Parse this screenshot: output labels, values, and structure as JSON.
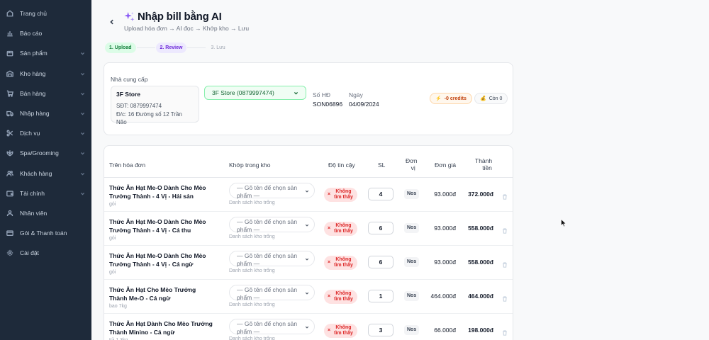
{
  "sidebar": {
    "items": [
      {
        "label": "Trang chủ",
        "icon": "home-icon",
        "chevron": false
      },
      {
        "label": "Báo cáo",
        "icon": "chart-icon",
        "chevron": false
      },
      {
        "label": "Sản phẩm",
        "icon": "box-icon",
        "chevron": true
      },
      {
        "label": "Kho hàng",
        "icon": "warehouse-icon",
        "chevron": true
      },
      {
        "label": "Bán hàng",
        "icon": "cart-icon",
        "chevron": true
      },
      {
        "label": "Nhập hàng",
        "icon": "truck-icon",
        "chevron": true
      },
      {
        "label": "Dịch vụ",
        "icon": "scissors-icon",
        "chevron": true
      },
      {
        "label": "Spa/Grooming",
        "icon": "spa-icon",
        "chevron": true
      },
      {
        "label": "Khách hàng",
        "icon": "users-icon",
        "chevron": true
      },
      {
        "label": "Tài chính",
        "icon": "wallet-icon",
        "chevron": true
      },
      {
        "label": "Nhân viên",
        "icon": "user-icon",
        "chevron": false
      },
      {
        "label": "Gói & Thanh toán",
        "icon": "card-icon",
        "chevron": false
      },
      {
        "label": "Cài đặt",
        "icon": "gear-icon",
        "chevron": false
      }
    ]
  },
  "header": {
    "title": "Nhập bill bằng AI",
    "subtitle": "Upload hóa đơn → AI đọc → Khớp kho → Lưu"
  },
  "steps": [
    "1. Upload",
    "2. Review",
    "3. Lưu"
  ],
  "supplier": {
    "label": "Nhà cung cấp",
    "name": "3F Store",
    "phone": "SĐT: 0879997474",
    "address": "Đ/c: 16 Đường số 12 Trần Não",
    "selected": "3F Store (0879997474)",
    "invoice_no_label": "Số HĐ",
    "invoice_no": "SON06896",
    "date_label": "Ngày",
    "date": "04/09/2024",
    "credits": "-0 credits",
    "remaining": "Còn 0"
  },
  "table": {
    "headers": {
      "name": "Trên hóa đơn",
      "match": "Khớp trong kho",
      "confidence": "Độ tin cậy",
      "qty": "SL",
      "unit_line1": "Đơn",
      "unit_line2": "vị",
      "price": "Đơn giá",
      "total_line1": "Thành",
      "total_line2": "tiền"
    },
    "match_placeholder_1": "— Gõ tên để chọn sản",
    "match_placeholder_2": "phẩm —",
    "empty_note": "Danh sách kho trống",
    "confidence_line1": "Không",
    "confidence_line2": "tìm thấy",
    "rows": [
      {
        "name": "Thức Ăn Hạt Me-O Dành Cho Mèo Trưởng Thành - 4 Vị - Hải sản",
        "unit_note": "gói",
        "qty": "4",
        "uom": "Nos",
        "price": "93.000đ",
        "total": "372.000đ"
      },
      {
        "name": "Thức Ăn Hạt Me-O Dành Cho Mèo Trưởng Thành - 4 Vị - Cá thu",
        "unit_note": "gói",
        "qty": "6",
        "uom": "Nos",
        "price": "93.000đ",
        "total": "558.000đ"
      },
      {
        "name": "Thức Ăn Hạt Me-O Dành Cho Mèo Trưởng Thành - 4 Vị - Cá ngừ",
        "unit_note": "gói",
        "qty": "6",
        "uom": "Nos",
        "price": "93.000đ",
        "total": "558.000đ"
      },
      {
        "name": "Thức Ăn Hạt Cho Mèo Trưởng Thành Me-O - Cá ngừ",
        "unit_note": "bao 7kg",
        "qty": "1",
        "uom": "Nos",
        "price": "464.000đ",
        "total": "464.000đ"
      },
      {
        "name": "Thức Ăn Hạt Dành Cho Mèo Trưởng Thành Minino - Cá ngừ",
        "unit_note": "túi 1.3kg",
        "qty": "3",
        "uom": "Nos",
        "price": "66.000đ",
        "total": "198.000đ"
      }
    ]
  },
  "colors": {
    "sidebar_bg": "#1e2a3a",
    "accent_green": "#16a34a",
    "accent_purple": "#7c3aed",
    "danger": "#dc2626"
  }
}
